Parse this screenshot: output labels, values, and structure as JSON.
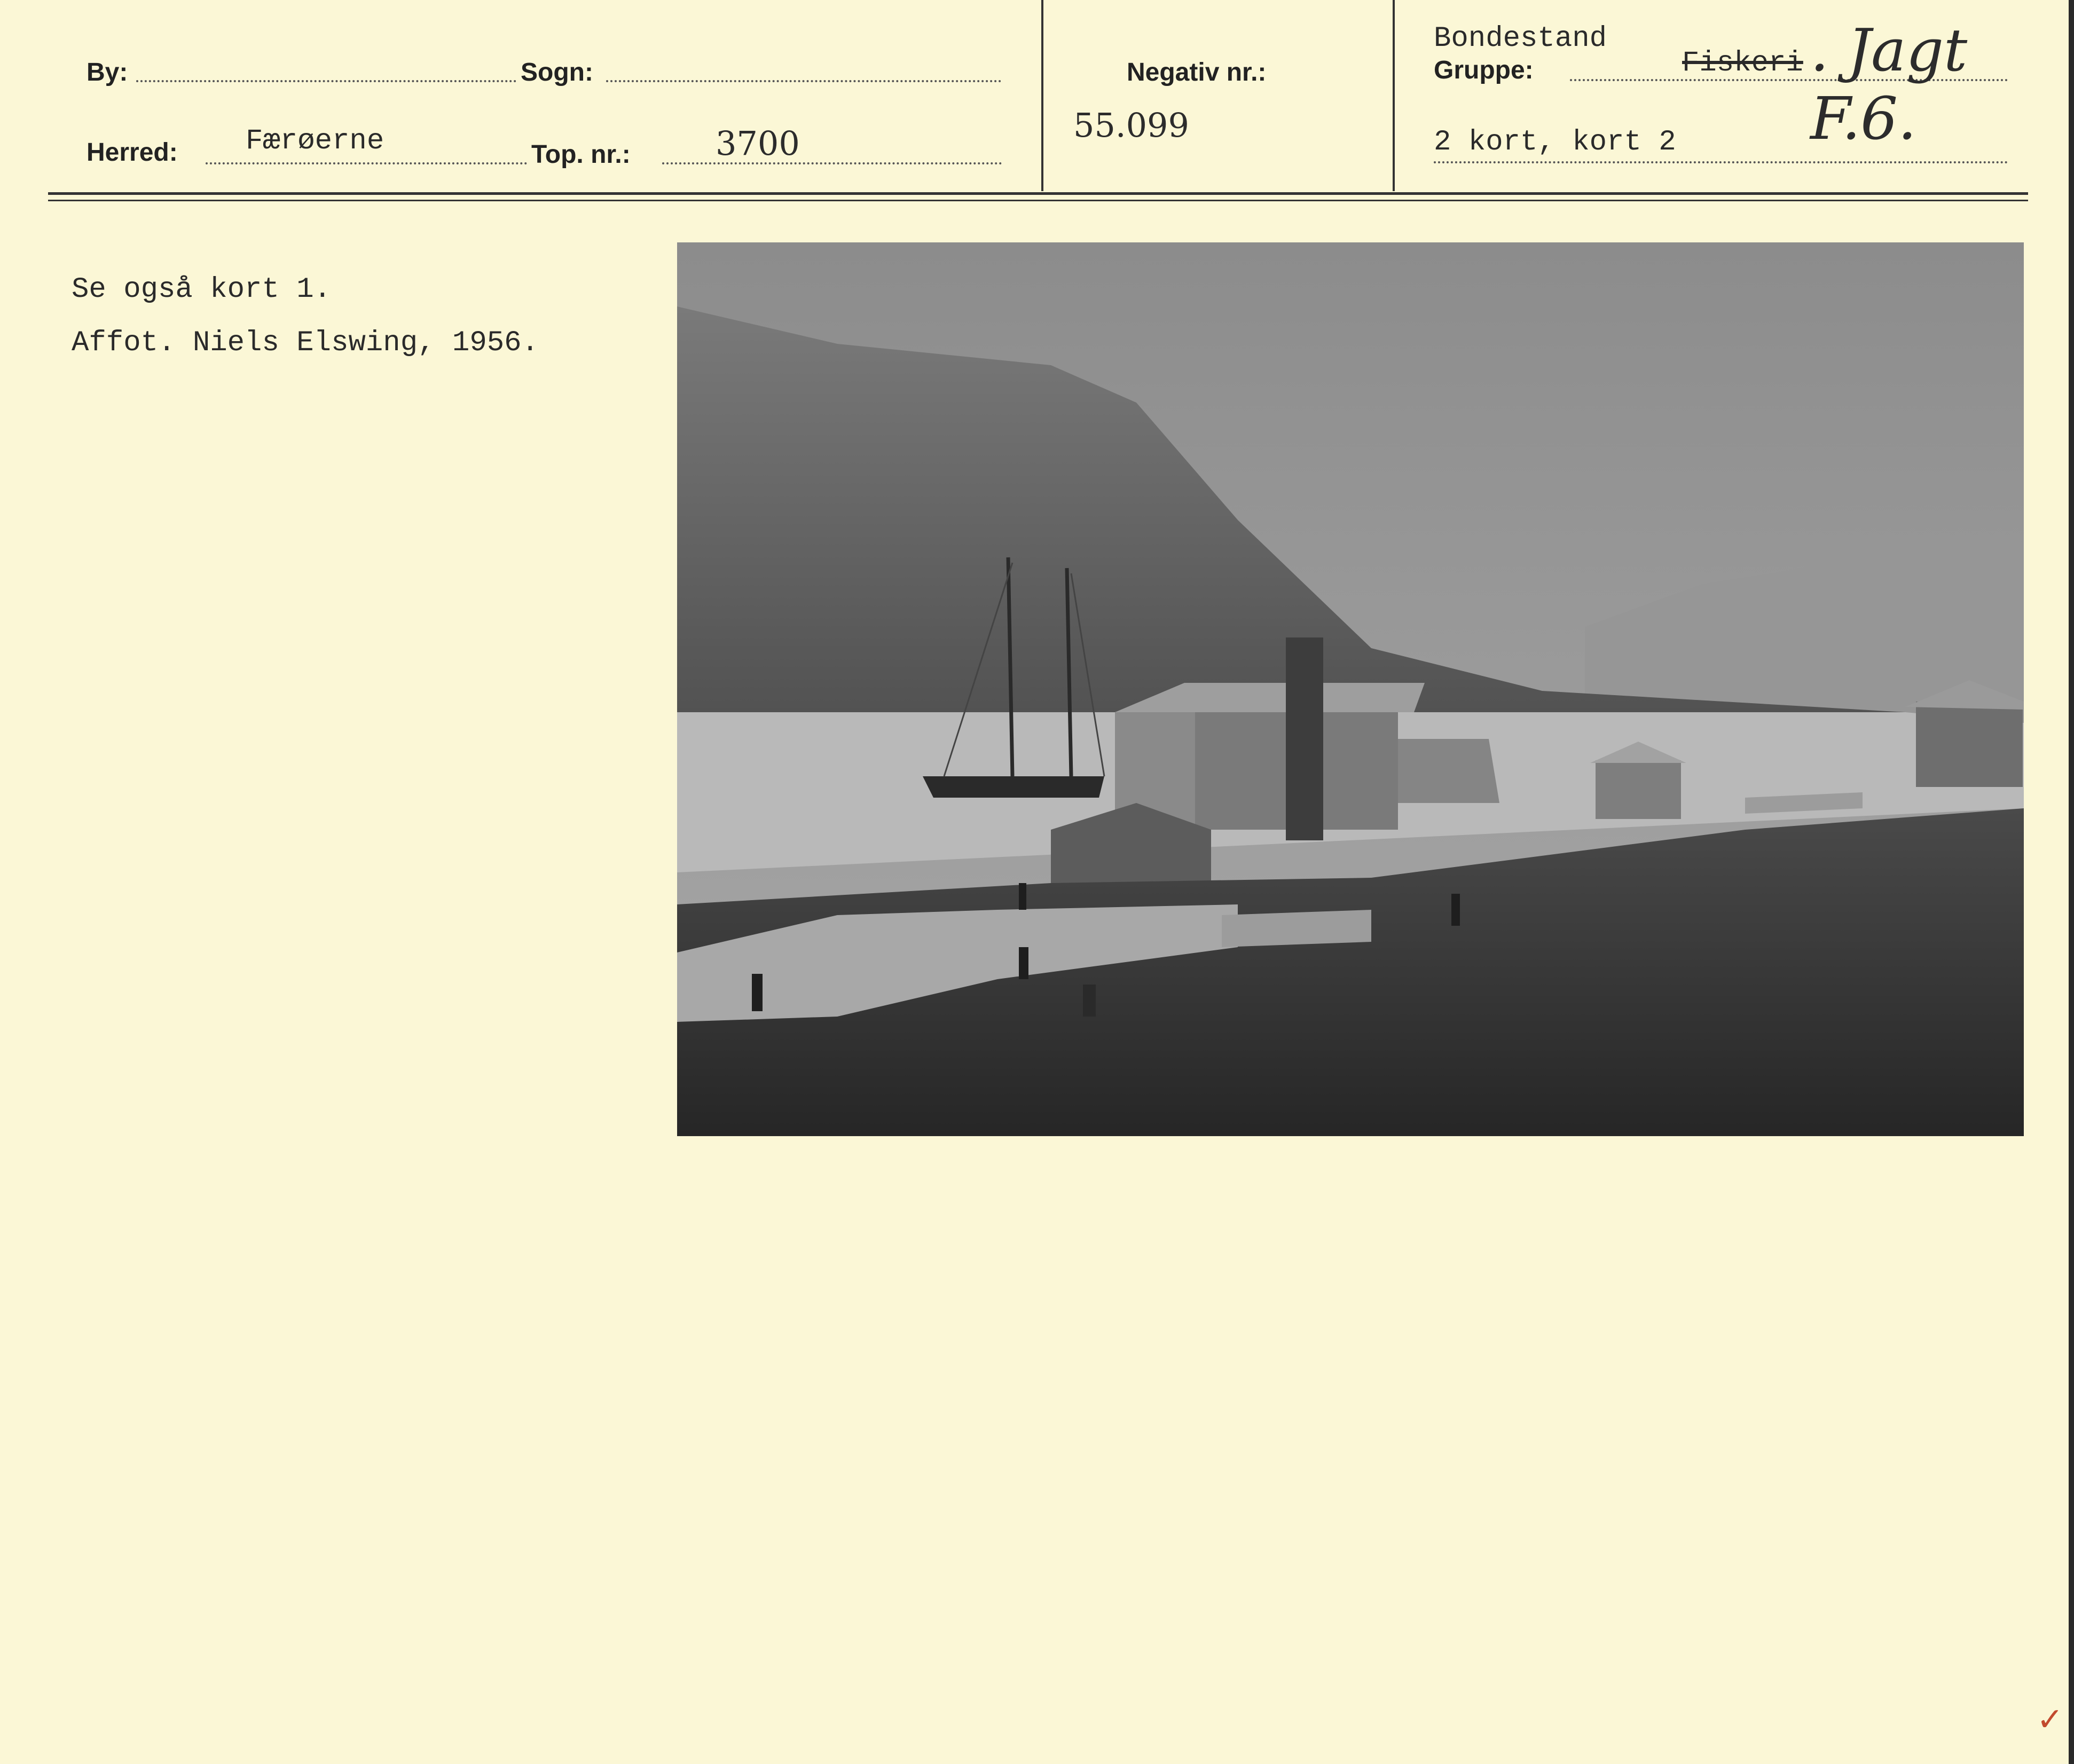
{
  "header": {
    "by_label": "By:",
    "sogn_label": "Sogn:",
    "herred_label": "Herred:",
    "herred_value": "Færøerne",
    "top_nr_label": "Top. nr.:",
    "top_nr_value": "3700",
    "negativ_label": "Negativ nr.:",
    "negativ_value": "55.099",
    "gruppe_pre": "Bondestand",
    "gruppe_label": "Gruppe:",
    "gruppe_struck": "Fiskeri",
    "gruppe_hand": ". Jagt F.6.",
    "kort_value": "2 kort, kort 2"
  },
  "notes": {
    "line1": "Se også kort 1.",
    "line2": "Affot. Niels Elswing, 1956."
  },
  "mark": "✓"
}
